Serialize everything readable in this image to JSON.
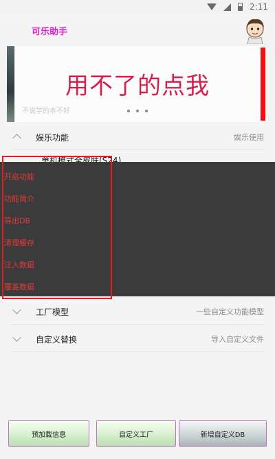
{
  "status_bar": {
    "time": "2:11"
  },
  "app": {
    "title": "可乐助手"
  },
  "banner": {
    "headline": "用不了的点我",
    "caption": "不说学的本不好"
  },
  "sections": [
    {
      "title": "娱乐功能",
      "subtitle": "娱乐使用",
      "expanded": true
    },
    {
      "title": "工厂模型",
      "subtitle": "一些自定义功能模型",
      "expanded": false
    },
    {
      "title": "自定义替换",
      "subtitle": "导入自定义文件",
      "expanded": false
    }
  ],
  "sub_item": "单机模式全皮肤(S24)",
  "context_menu": {
    "items": [
      "开启功能",
      "功能简介",
      "导出DB",
      "清理缓存",
      "注入数据",
      "覆盖数据"
    ]
  },
  "bottom_buttons": [
    "预加载信息",
    "自定义工厂",
    "新增自定义DB"
  ],
  "colors": {
    "app_title": "#e01ed6",
    "banner_text": "#d81e4c",
    "menu_text": "#e23a3a",
    "menu_border": "#e02020",
    "menu_bg": "#3b3b3b"
  }
}
